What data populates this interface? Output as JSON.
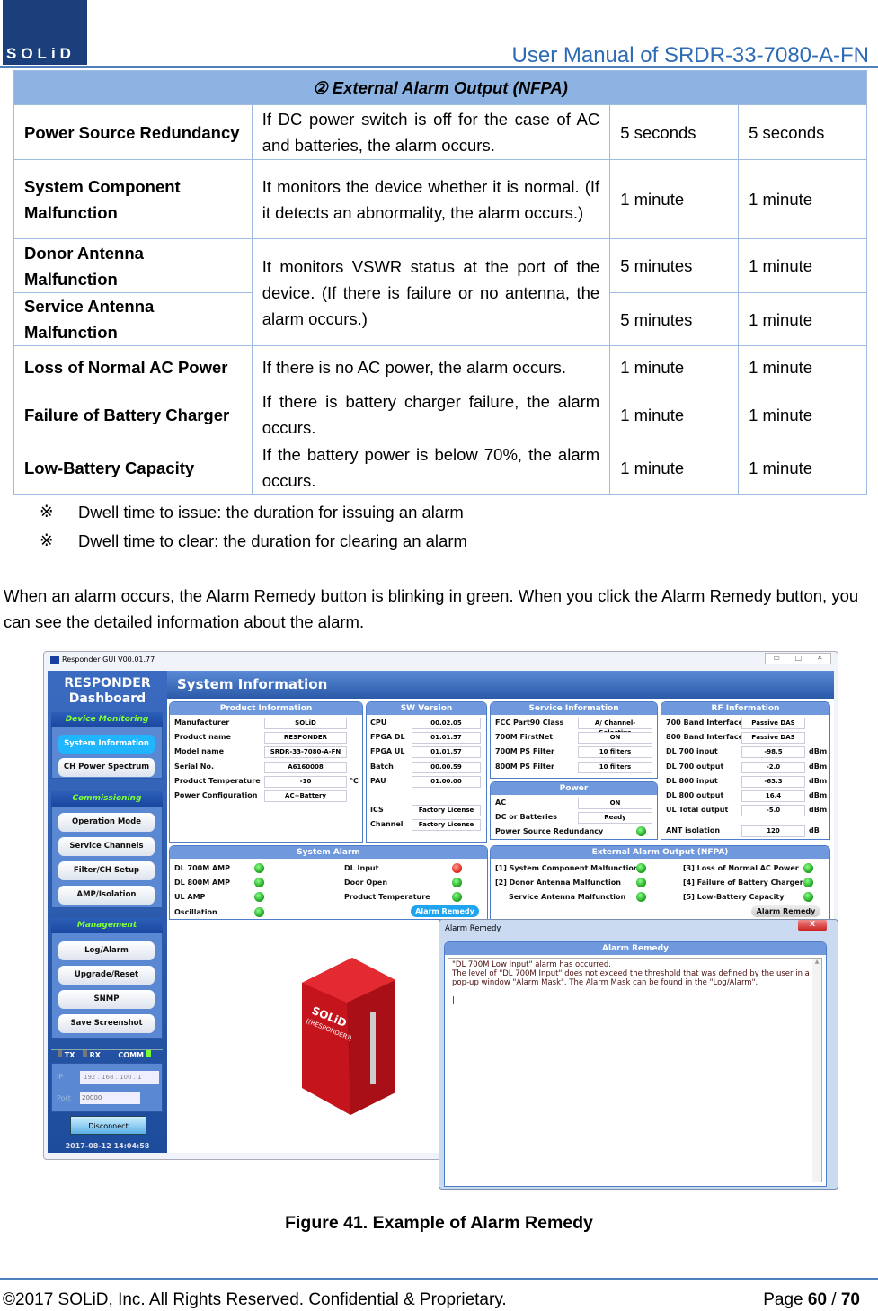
{
  "header": {
    "logo_text": "SOLiD",
    "title": "User Manual of SRDR-33-7080-A-FN"
  },
  "table": {
    "title": "② External Alarm Output (NFPA)",
    "rows": [
      {
        "name": "Power Source Redundancy",
        "desc": "If DC power switch is off for the case of AC and batteries, the alarm occurs.",
        "issue": "5 seconds",
        "clear": "5 seconds"
      },
      {
        "name": "System Component Malfunction",
        "desc": "It monitors the device whether it is normal. (If it detects an abnormality, the alarm occurs.)",
        "issue": "1 minute",
        "clear": "1 minute"
      },
      {
        "name": "Donor Antenna Malfunction",
        "desc": "It monitors VSWR status at the port of the device. (If there is failure or no antenna, the alarm occurs.)",
        "issue": "5 minutes",
        "clear": "1 minute"
      },
      {
        "name": "Service Antenna Malfunction",
        "issue": "5 minutes",
        "clear": "1 minute"
      },
      {
        "name": "Loss of Normal AC Power",
        "desc": "If there is no AC power, the alarm occurs.",
        "issue": "1 minute",
        "clear": "1 minute"
      },
      {
        "name": "Failure of Battery Charger",
        "desc": "If there is battery charger failure, the alarm occurs.",
        "issue": "1 minute",
        "clear": "1 minute"
      },
      {
        "name": "Low-Battery Capacity",
        "desc": "If the battery power is below 70%, the alarm occurs.",
        "issue": "1 minute",
        "clear": "1 minute"
      }
    ]
  },
  "notes": {
    "mark": "※",
    "n1": "Dwell time to issue: the duration for issuing an alarm",
    "n2": "Dwell time to clear: the duration for clearing an alarm"
  },
  "paragraph": "When an alarm occurs, the Alarm Remedy button is blinking in green. When you click the Alarm Remedy button, you can see the detailed information about the alarm.",
  "gui": {
    "window_title": "Responder GUI V00.01.77",
    "dash_title1": "RESPONDER",
    "dash_title2": "Dashboard",
    "main_title": "System Information",
    "sections": [
      {
        "title": "Device Monitoring",
        "buttons": [
          "System Information",
          "CH Power Spectrum"
        ],
        "active": 0
      },
      {
        "title": "Commissioning",
        "buttons": [
          "Operation Mode",
          "Service Channels",
          "Filter/CH Setup",
          "AMP/Isolation"
        ]
      },
      {
        "title": "Management",
        "buttons": [
          "Log/Alarm",
          "Upgrade/Reset",
          "SNMP",
          "Save Screenshot"
        ]
      }
    ],
    "comm": {
      "tx": "TX",
      "rx": "RX",
      "comm": "COMM",
      "ip_label": "IP",
      "ip": "192 . 168 . 100 .  1",
      "port_label": "Port",
      "port": "20000",
      "disconnect": "Disconnect",
      "datetime": "2017-08-12 14:04:58"
    },
    "product_info": {
      "title": "Product Information",
      "rows": [
        [
          "Manufacturer",
          "SOLiD"
        ],
        [
          "Product name",
          "RESPONDER"
        ],
        [
          "Model name",
          "SRDR-33-7080-A-FN"
        ],
        [
          "Serial No.",
          "A6160008"
        ],
        [
          "Product Temperature",
          "-10",
          "℃"
        ],
        [
          "Power Configuration",
          "AC+Battery"
        ]
      ]
    },
    "sw_version": {
      "title": "SW Version",
      "rows": [
        [
          "CPU",
          "00.02.05"
        ],
        [
          "FPGA DL",
          "01.01.57"
        ],
        [
          "FPGA UL",
          "01.01.57"
        ],
        [
          "Batch",
          "00.00.59"
        ],
        [
          "PAU",
          "01.00.00"
        ]
      ],
      "rows2": [
        [
          "ICS",
          "Factory License"
        ],
        [
          "Channel",
          "Factory License"
        ]
      ]
    },
    "service_info": {
      "title": "Service Information",
      "rows": [
        [
          "FCC Part90 Class",
          "A/ Channel-Selective"
        ],
        [
          "700M FirstNet",
          "ON"
        ],
        [
          "700M PS Filter",
          "10 filters"
        ],
        [
          "800M PS Filter",
          "10 filters"
        ]
      ]
    },
    "power": {
      "title": "Power",
      "rows": [
        [
          "AC",
          "ON"
        ],
        [
          "DC or Batteries",
          "Ready"
        ]
      ],
      "redundancy": "Power Source Redundancy",
      "redundancy_status": "green"
    },
    "rf_info": {
      "title": "RF Information",
      "rows": [
        [
          "700 Band Interface",
          "Passive DAS",
          ""
        ],
        [
          "800 Band Interface",
          "Passive DAS",
          ""
        ],
        [
          "DL 700 input",
          "-98.5",
          "dBm"
        ],
        [
          "DL 700 output",
          "-2.0",
          "dBm"
        ],
        [
          "DL 800 input",
          "-63.3",
          "dBm"
        ],
        [
          "DL 800 output",
          "16.4",
          "dBm"
        ],
        [
          "UL Total output",
          "-5.0",
          "dBm"
        ]
      ],
      "ant": [
        "ANT isolation",
        "120",
        "dB"
      ]
    },
    "system_alarm": {
      "title": "System Alarm",
      "left": [
        [
          "DL 700M AMP",
          "green"
        ],
        [
          "DL 800M AMP",
          "green"
        ],
        [
          "UL AMP",
          "green"
        ],
        [
          "Oscillation",
          "green"
        ]
      ],
      "right": [
        [
          "DL Input",
          "red"
        ],
        [
          "Door Open",
          "green"
        ],
        [
          "Product Temperature",
          "green"
        ]
      ],
      "button": "Alarm Remedy"
    },
    "external_alarm": {
      "title": "External Alarm Output (NFPA)",
      "left": [
        [
          "[1] System Component Malfunction",
          "green"
        ],
        [
          "[2] Donor Antenna Malfunction",
          "green"
        ],
        [
          "Service Antenna Malfunction",
          "green"
        ]
      ],
      "right": [
        [
          "[3] Loss of Normal AC Power",
          "green"
        ],
        [
          "[4] Failure of Battery Charger",
          "green"
        ],
        [
          "[5] Low-Battery Capacity",
          "green"
        ]
      ],
      "button": "Alarm Remedy"
    },
    "device_image": {
      "brand": "SOLiD",
      "model": "((RESPONDER))"
    },
    "popup": {
      "title": "Alarm Remedy",
      "header": "Alarm Remedy",
      "line1": "\"DL 700M Low Input\" alarm has occurred.",
      "line2": "The level of \"DL 700M Input\" does not exceed the threshold that was defined by the user in a pop-up window \"Alarm Mask\". The Alarm Mask can be found in the \"Log/Alarm\".",
      "close": "X"
    }
  },
  "caption": "Figure 41. Example of Alarm Remedy",
  "footer": {
    "copyright": "©2017 SOLiD, Inc. All Rights Reserved. Confidential & Proprietary.",
    "page_label": "Page ",
    "page": "60",
    "sep": " / ",
    "total": "70"
  },
  "colors": {
    "accent": "#4f81bd",
    "table_header": "#8db3e2",
    "logo": "#1a3f7a"
  }
}
